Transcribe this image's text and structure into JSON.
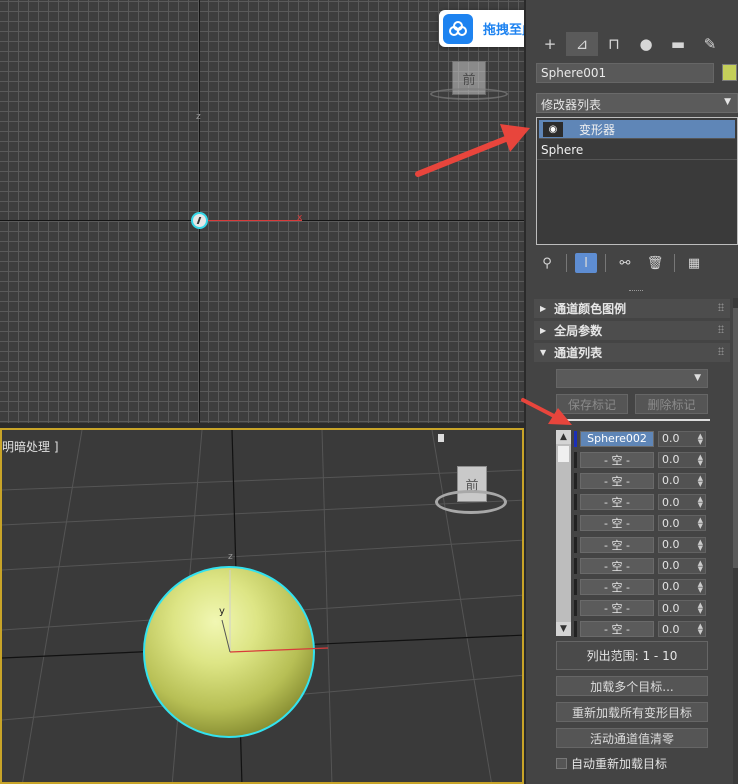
{
  "upload_badge": {
    "label": "拖拽至此上传"
  },
  "viewport_top": {
    "axis_z": "z",
    "axis_x": "x"
  },
  "viewport_persp": {
    "label": "明暗处理 ]",
    "viewcube_face": "前",
    "axis_z": "z",
    "axis_y": "y"
  },
  "viewport_top_cube": {
    "face": "前"
  },
  "command_panel": {
    "tabs": [
      {
        "icon": "create-icon"
      },
      {
        "icon": "modify-icon"
      },
      {
        "icon": "hierarchy-icon"
      },
      {
        "icon": "motion-icon"
      },
      {
        "icon": "display-icon"
      },
      {
        "icon": "utilities-icon"
      }
    ],
    "object_name": "Sphere001",
    "object_color": "#c4cf5a",
    "modifier_list": "修改器列表",
    "stack": [
      {
        "label": "变形器",
        "selected": true
      },
      {
        "label": "Sphere",
        "selected": false
      }
    ],
    "rollouts": {
      "channel_color_legend": "通道颜色图例",
      "global_params": "全局参数",
      "channel_list": "通道列表"
    },
    "buttons": {
      "save_marker": "保存标记",
      "delete_marker": "删除标记",
      "load_multiple": "加载多个目标...",
      "reload_all": "重新加载所有变形目标",
      "zero_active": "活动通道值清零"
    },
    "channels": [
      {
        "name": "Sphere002",
        "value": "0.0",
        "selected": true
      },
      {
        "name": "- 空 -",
        "value": "0.0",
        "selected": false
      },
      {
        "name": "- 空 -",
        "value": "0.0",
        "selected": false
      },
      {
        "name": "- 空 -",
        "value": "0.0",
        "selected": false
      },
      {
        "name": "- 空 -",
        "value": "0.0",
        "selected": false
      },
      {
        "name": "- 空 -",
        "value": "0.0",
        "selected": false
      },
      {
        "name": "- 空 -",
        "value": "0.0",
        "selected": false
      },
      {
        "name": "- 空 -",
        "value": "0.0",
        "selected": false
      },
      {
        "name": "- 空 -",
        "value": "0.0",
        "selected": false
      },
      {
        "name": "- 空 -",
        "value": "0.0",
        "selected": false
      }
    ],
    "list_range": "列出范围:   1 - 10",
    "auto_reload": "自动重新加载目标"
  },
  "colors": {
    "accent_selection": "#5f86b7",
    "viewport_active_border": "#c8a428",
    "annotation_arrow": "#e8453c"
  }
}
